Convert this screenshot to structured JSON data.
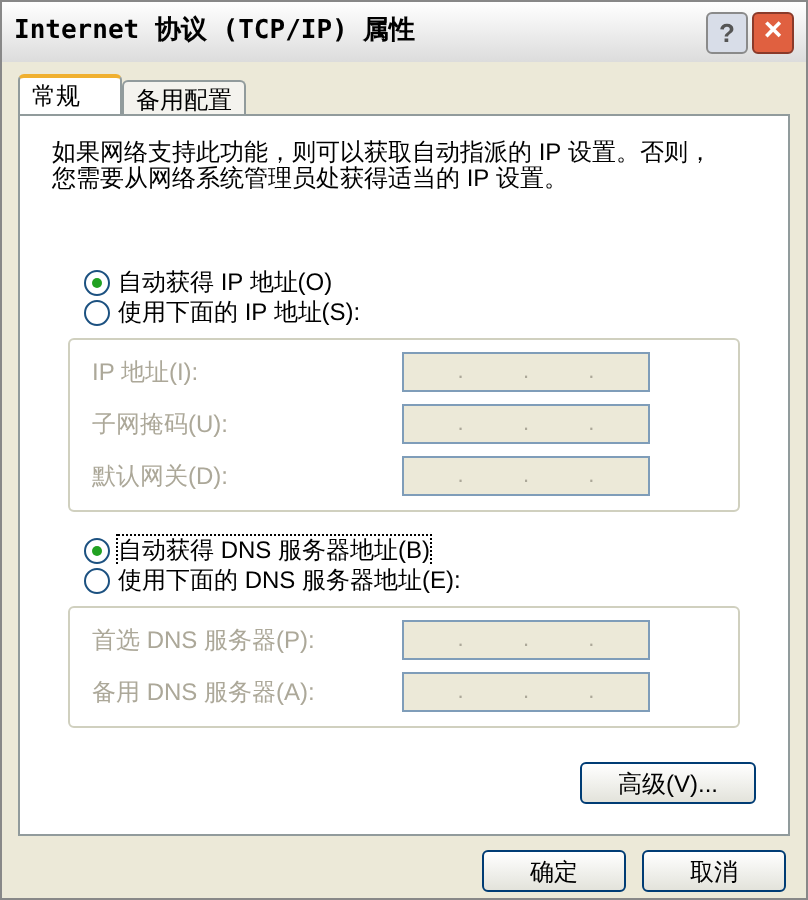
{
  "window": {
    "title": "Internet 协议 (TCP/IP) 属性",
    "help_button": "?",
    "close_button": "×"
  },
  "tabs": [
    {
      "label": "常规",
      "selected": true
    },
    {
      "label": "备用配置",
      "selected": false
    }
  ],
  "description": "如果网络支持此功能，则可以获取自动指派的 IP 设置。否则，您需要从网络系统管理员处获得适当的 IP 设置。",
  "ip_section": {
    "options": [
      {
        "label": "自动获得 IP 地址(O)",
        "selected": true,
        "focused": false
      },
      {
        "label": "使用下面的 IP 地址(S):",
        "selected": false,
        "focused": false
      }
    ],
    "fields": [
      {
        "label": "IP 地址(I):",
        "disabled": true,
        "dots": [
          ".",
          ".",
          "."
        ]
      },
      {
        "label": "子网掩码(U):",
        "disabled": true,
        "dots": [
          ".",
          ".",
          "."
        ]
      },
      {
        "label": "默认网关(D):",
        "disabled": true,
        "dots": [
          ".",
          ".",
          "."
        ]
      }
    ]
  },
  "dns_section": {
    "options": [
      {
        "label": "自动获得 DNS 服务器地址(B)",
        "selected": true,
        "focused": true
      },
      {
        "label": "使用下面的 DNS 服务器地址(E):",
        "selected": false,
        "focused": false
      }
    ],
    "fields": [
      {
        "label": "首选 DNS 服务器(P):",
        "disabled": true,
        "dots": [
          ".",
          ".",
          "."
        ]
      },
      {
        "label": "备用 DNS 服务器(A):",
        "disabled": true,
        "dots": [
          ".",
          ".",
          "."
        ]
      }
    ]
  },
  "advanced_button": "高级(V)...",
  "buttons": [
    "确定",
    "取消"
  ]
}
